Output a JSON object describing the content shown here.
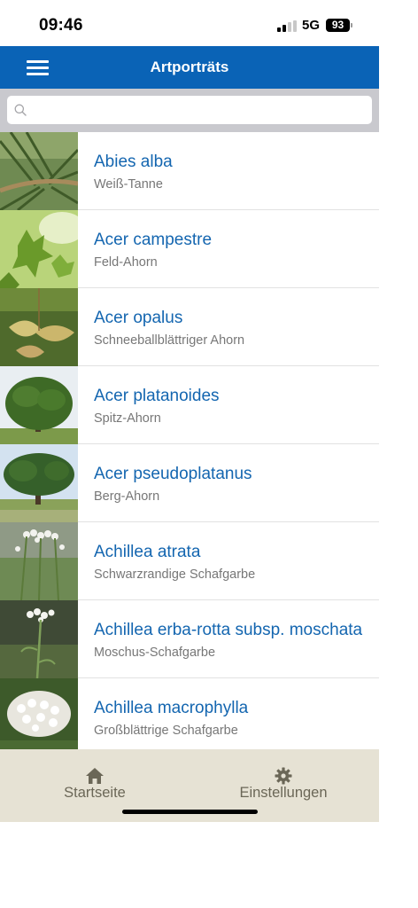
{
  "status_bar": {
    "time": "09:46",
    "network": "5G",
    "battery": "93"
  },
  "header": {
    "title": "Artporträts",
    "menu_icon": "hamburger-menu-icon"
  },
  "search": {
    "placeholder": "",
    "value": "",
    "icon": "search-icon"
  },
  "species": [
    {
      "name": "Abies alba",
      "common": "Weiß-Tanne"
    },
    {
      "name": "Acer campestre",
      "common": "Feld-Ahorn"
    },
    {
      "name": "Acer opalus",
      "common": "Schneeballblättriger Ahorn"
    },
    {
      "name": "Acer platanoides",
      "common": "Spitz-Ahorn"
    },
    {
      "name": "Acer pseudoplatanus",
      "common": "Berg-Ahorn"
    },
    {
      "name": "Achillea atrata",
      "common": "Schwarzrandige Schafgarbe"
    },
    {
      "name": "Achillea erba-rotta subsp. moschata",
      "common": "Moschus-Schafgarbe"
    },
    {
      "name": "Achillea macrophylla",
      "common": "Großblättrige Schafgarbe"
    }
  ],
  "tabs": {
    "home": {
      "label": "Startseite",
      "icon": "home-icon"
    },
    "settings": {
      "label": "Einstellungen",
      "icon": "gear-icon"
    }
  },
  "colors": {
    "header": "#0a63b6",
    "link": "#1466b0",
    "subtitle": "#777777",
    "tab_bar": "#e6e2d4",
    "tab_text": "#6b6757",
    "search_bar": "#c9c9ce"
  }
}
